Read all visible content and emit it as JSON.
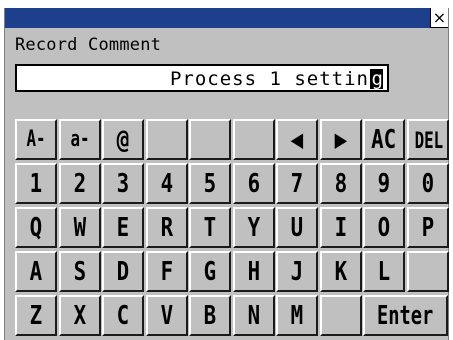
{
  "window": {
    "close_glyph": "×"
  },
  "dialog": {
    "label": "Record Comment",
    "input_value": "Process 1 settin",
    "caret_char": "g"
  },
  "keyboard": {
    "rows": [
      [
        "A-Z",
        "a-z",
        "@",
        "",
        "",
        "",
        "◀",
        "▶",
        "AC",
        "DEL"
      ],
      [
        "1",
        "2",
        "3",
        "4",
        "5",
        "6",
        "7",
        "8",
        "9",
        "0"
      ],
      [
        "Q",
        "W",
        "E",
        "R",
        "T",
        "Y",
        "U",
        "I",
        "O",
        "P"
      ],
      [
        "A",
        "S",
        "D",
        "F",
        "G",
        "H",
        "J",
        "K",
        "L",
        ""
      ],
      [
        "Z",
        "X",
        "C",
        "V",
        "B",
        "N",
        "M",
        "",
        "Enter"
      ]
    ]
  }
}
